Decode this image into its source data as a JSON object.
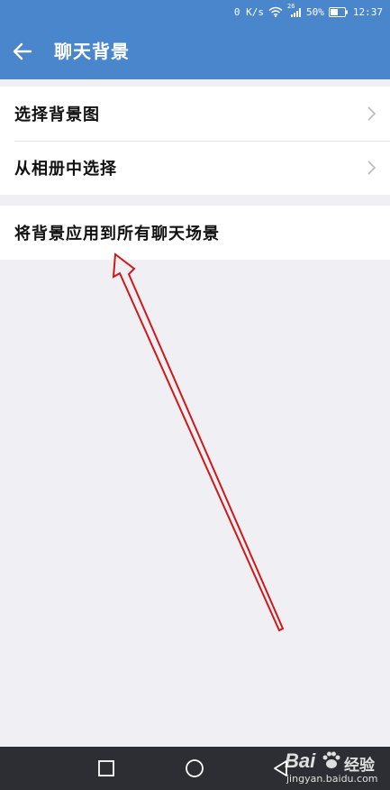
{
  "status_bar": {
    "speed": "0 K/s",
    "network_badge": "26",
    "battery": "50%",
    "time": "12:37"
  },
  "app_bar": {
    "title": "聊天背景"
  },
  "settings": {
    "group_1": [
      {
        "label": "选择背景图"
      },
      {
        "label": "从相册中选择"
      }
    ],
    "group_2": [
      {
        "label": "将背景应用到所有聊天场景"
      }
    ]
  },
  "watermark": {
    "brand": "Bai",
    "sub": "经验",
    "url": "jingyan.baidu.com"
  },
  "colors": {
    "app_bar": "#4a86cc",
    "page_background": "#efeff4",
    "annotation_arrow": "#d01818",
    "nav_bar": "#2d2e33"
  },
  "icons": {
    "back": "arrow-left-icon",
    "chevron": "chevron-right-icon",
    "wifi": "wifi-icon",
    "signal": "signal-icon",
    "battery": "battery-icon",
    "recent_apps": "square-icon",
    "home": "circle-icon",
    "nav_back": "triangle-back-icon"
  }
}
